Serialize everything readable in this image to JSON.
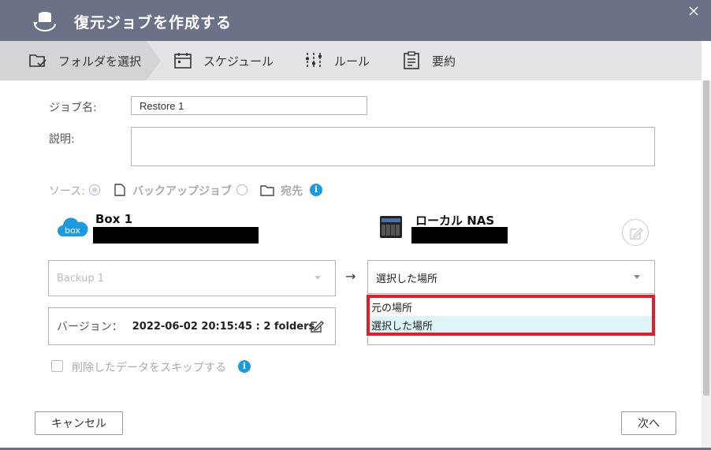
{
  "window": {
    "title": "復元ジョブを作成する"
  },
  "steps": [
    {
      "label": "フォルダを選択"
    },
    {
      "label": "スケジュール"
    },
    {
      "label": "ルール"
    },
    {
      "label": "要約"
    }
  ],
  "form": {
    "job_name_label": "ジョブ名:",
    "job_name_value": "Restore 1",
    "description_label": "説明:",
    "source_label": "ソース:",
    "source_option_backup": "バックアップジョブ",
    "source_option_destination": "宛先"
  },
  "source_endpoint": {
    "name": "Box 1",
    "job_select": "Backup 1"
  },
  "target_endpoint": {
    "name": "ローカル NAS",
    "location_select": "選択した場所"
  },
  "arrow": "→",
  "dropdown": {
    "options": [
      "元の場所",
      "選択した場所"
    ],
    "selected_index": 1
  },
  "version": {
    "label": "バージョン：",
    "value": "2022-06-02 20:15:45 : 2 folders"
  },
  "skip_deleted_label": "削除したデータをスキップする",
  "buttons": {
    "cancel": "キャンセル",
    "next": "次へ"
  },
  "icons": {
    "info": "i",
    "box_logo": "box"
  },
  "colors": {
    "titlebar": "#6b7186",
    "accent": "#1b9ae0",
    "highlight": "#e11d2a"
  }
}
